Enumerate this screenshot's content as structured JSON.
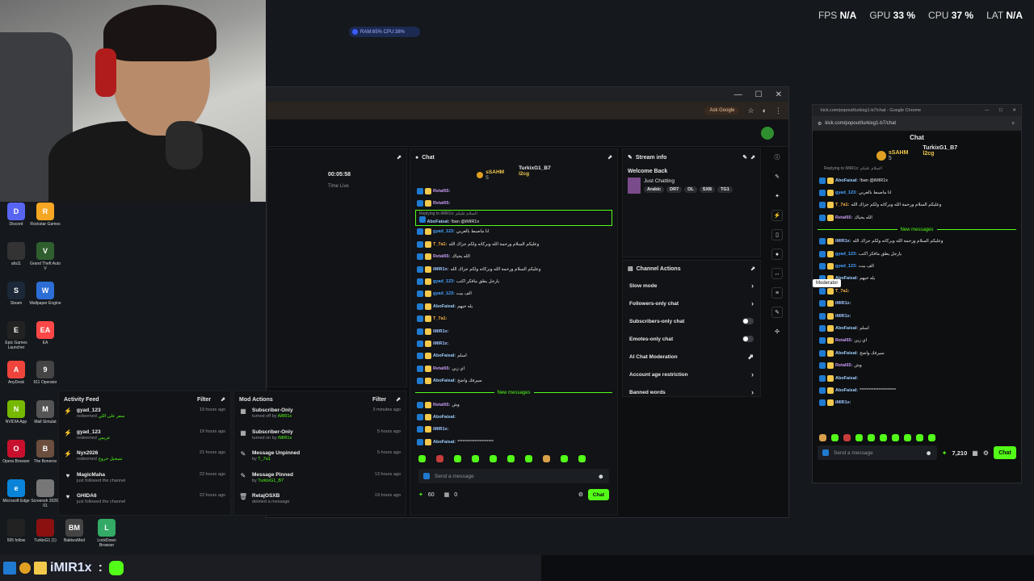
{
  "overlay": {
    "fps_label": "FPS",
    "fps_value": "N/A",
    "gpu_label": "GPU",
    "gpu_value": "33 %",
    "cpu_label": "CPU",
    "cpu_value": "37 %",
    "lat_label": "LAT",
    "lat_value": "N/A",
    "ram_pill": "RAM:65% CPU:38%"
  },
  "desktop_icons": [
    {
      "label": "Discord",
      "color": "#5865f2",
      "glyph": "D"
    },
    {
      "label": "Rockstar Games",
      "color": "#f5a623",
      "glyph": "R"
    },
    {
      "label": "afa11",
      "color": "#333",
      "glyph": ""
    },
    {
      "label": "Grand Theft Auto V",
      "color": "#2f5f2f",
      "glyph": "V"
    },
    {
      "label": "Steam",
      "color": "#1b2838",
      "glyph": "S"
    },
    {
      "label": "Wallpaper Engine",
      "color": "#2c6ed5",
      "glyph": "W"
    },
    {
      "label": "Epic Games Launcher",
      "color": "#222",
      "glyph": "E"
    },
    {
      "label": "EA",
      "color": "#ff4747",
      "glyph": "EA"
    },
    {
      "label": "AnyDesk",
      "color": "#ef443b",
      "glyph": "A"
    },
    {
      "label": "911 Operator",
      "color": "#444",
      "glyph": "9"
    },
    {
      "label": "NVIDIA App",
      "color": "#76b900",
      "glyph": "N"
    },
    {
      "label": "Mall Simulat",
      "color": "#555",
      "glyph": "M"
    },
    {
      "label": "Opera Browser",
      "color": "#c8102e",
      "glyph": "O"
    },
    {
      "label": "The Bonerov",
      "color": "#6b4e3d",
      "glyph": "B"
    },
    {
      "label": "Microsoft Edge",
      "color": "#0a84d8",
      "glyph": "e"
    },
    {
      "label": "Screensh 2026-01",
      "color": "#777",
      "glyph": ""
    },
    {
      "label": "505 follow",
      "color": "#222",
      "glyph": ""
    },
    {
      "label": "TurkixG1 (1)",
      "color": "#8b1111",
      "glyph": ""
    },
    {
      "label": "BakkesMod",
      "color": "#444",
      "glyph": "BM"
    },
    {
      "label": "LockDown Browser",
      "color": "#3a6",
      "glyph": "L"
    }
  ],
  "browser": {
    "ask_google": "Ask Google",
    "dashboard_timer": "00:05:58",
    "time_live": "Time Live"
  },
  "activity_feed": {
    "title": "Activity Feed",
    "filter": "Filter",
    "items": [
      {
        "icon": "⚡",
        "name": "gyad_123",
        "action": "redeemed",
        "detail": "سفر على اللي",
        "time": "19 hours ago"
      },
      {
        "icon": "⚡",
        "name": "gyad_123",
        "action": "redeemed",
        "detail": "عريس",
        "time": "19 hours ago"
      },
      {
        "icon": "⚡",
        "name": "Nyx2026",
        "action": "redeemed",
        "detail": "تسجيل خروج",
        "time": "21 hours ago"
      },
      {
        "icon": "♥",
        "name": "MagicMaha",
        "action": "just followed the channel",
        "detail": "",
        "time": "22 hours ago"
      },
      {
        "icon": "♥",
        "name": "GHIDA6",
        "action": "just followed the channel",
        "detail": "",
        "time": "22 hours ago"
      }
    ]
  },
  "mod_actions": {
    "title": "Mod Actions",
    "filter": "Filter",
    "items": [
      {
        "icon": "▦",
        "title": "Subscriber-Only",
        "by": "turned off by ",
        "user": "iMIR1x",
        "time": "3 minutes ago"
      },
      {
        "icon": "▦",
        "title": "Subscriber-Only",
        "by": "turned on by ",
        "user": "iMIR1x",
        "time": "5 hours ago"
      },
      {
        "icon": "✎",
        "title": "Message Unpinned",
        "by": "by ",
        "user": "T_7a1",
        "time": "5 hours ago"
      },
      {
        "icon": "✎",
        "title": "Message Pinned",
        "by": "by ",
        "user": "TurkixG1_B7",
        "time": "13 hours ago"
      },
      {
        "icon": "🗑",
        "title": "RetajOSXB",
        "by": "deleted a message",
        "user": "",
        "time": "19 hours ago"
      }
    ]
  },
  "chat": {
    "title": "Chat",
    "top1_name": "sSAHM",
    "top1_count": "5",
    "top2_name": "TurkixG1_B7",
    "top2_count": "5",
    "top3_name": "l2cg",
    "top3_count": "5",
    "reply_hint": "Replying to iMIR1x: السلام عليكم",
    "reply_user": "AboFaisal:",
    "reply_msg": "!ban @iMIR1x",
    "lines": [
      {
        "user": "Retal65:",
        "cls": "u-retal",
        "msg": ""
      },
      {
        "user": "Retal65:",
        "cls": "u-retal",
        "msg": ""
      },
      {
        "user": "gyad_123:",
        "cls": "u-gyad",
        "msg": "انا ماصبط بالعربي"
      },
      {
        "user": "T_7a1:",
        "cls": "u-t7",
        "msg": "وعليكم السلام ورحمة الله وبركاته ولكم جزاك الله"
      },
      {
        "user": "Retal65:",
        "cls": "u-retal",
        "msg": "الله يحياك"
      },
      {
        "user": "iMIR1x:",
        "cls": "u-imir",
        "msg": "وعليكم السلام ورحمة الله وبركاته ولكم جزاك الله"
      },
      {
        "user": "gyad_123:",
        "cls": "u-gyad",
        "msg": "يارجل يطق مافكر اكتب"
      },
      {
        "user": "gyad_123:",
        "cls": "u-gyad",
        "msg": "الف بيت"
      },
      {
        "user": "AboFaisal:",
        "cls": "u-abo",
        "msg": "يله حيهم"
      },
      {
        "user": "T_7a1:",
        "cls": "u-t7",
        "msg": ""
      },
      {
        "user": "iMIR1x:",
        "cls": "u-imir",
        "msg": ""
      },
      {
        "user": "iMIR1x:",
        "cls": "u-imir",
        "msg": ""
      },
      {
        "user": "AboFaisal:",
        "cls": "u-abo",
        "msg": "اسلم"
      },
      {
        "user": "Retal65:",
        "cls": "u-retal",
        "msg": "اي زين"
      },
      {
        "user": "AboFaisal:",
        "cls": "u-abo",
        "msg": "سيرفك واضح"
      }
    ],
    "new_messages": "New messages",
    "lines_after": [
      {
        "user": "Retal65:",
        "cls": "u-retal",
        "msg": "وش"
      },
      {
        "user": "AboFaisal:",
        "cls": "u-abo",
        "msg": ""
      },
      {
        "user": "iMIR1x:",
        "cls": "u-imir",
        "msg": ""
      },
      {
        "user": "AboFaisal:",
        "cls": "u-abo",
        "msg": "*********************"
      }
    ],
    "placeholder": "Send a message",
    "points": "60",
    "gift": "0",
    "send_label": "Chat"
  },
  "stream_info": {
    "title": "Stream info",
    "welcome": "Welcome Back",
    "category": "Just Chatting",
    "tags": [
      "Arabic",
      "DR7",
      "OL",
      "SXB",
      "TG1"
    ]
  },
  "channel_actions": {
    "title": "Channel Actions",
    "items": [
      {
        "label": "Slow mode",
        "type": "chevron"
      },
      {
        "label": "Followers-only chat",
        "type": "chevron"
      },
      {
        "label": "Subscribers-only chat",
        "type": "toggle"
      },
      {
        "label": "Emotes-only chat",
        "type": "toggle"
      },
      {
        "label": "AI Chat Moderation",
        "type": "external"
      },
      {
        "label": "Account age restriction",
        "type": "chevron"
      },
      {
        "label": "Banned words",
        "type": "chevron"
      }
    ]
  },
  "popout": {
    "window_title": "kick.com/popout/turkixg1-b7/chat - Google Chrome",
    "url": "kick.com/popout/turkixg1-b7/chat",
    "title": "Chat",
    "top1_name": "sSAHM",
    "top1_count": "5",
    "top2_name": "TurkixG1_B7",
    "top2_count": "5",
    "top3_name": "l2cg",
    "top3_count": "5",
    "reply_hint": "Replying to iMIR1x: السلام عليكم",
    "tooltip": "Moderator",
    "lines": [
      {
        "user": "AboFaisal:",
        "cls": "u-abo",
        "msg": "!ban @iMIR1x"
      },
      {
        "user": "gyad_123:",
        "cls": "u-gyad",
        "msg": "انا ماصبط بالعربي"
      },
      {
        "user": "T_7a1:",
        "cls": "u-t7",
        "msg": "وعليكم السلام ورحمة الله وبركاته ولكم جزاك الله"
      },
      {
        "user": "Retal65:",
        "cls": "u-retal",
        "msg": "الله يحياك"
      }
    ],
    "new_messages": "New messages",
    "lines_after": [
      {
        "user": "iMIR1x:",
        "cls": "u-imir",
        "msg": "وعليكم السلام ورحمة الله وبركاته ولكم جزاك الله"
      },
      {
        "user": "gyad_123:",
        "cls": "u-gyad",
        "msg": "يارجل يطق مافكر اكتب"
      },
      {
        "user": "gyad_123:",
        "cls": "u-gyad",
        "msg": "الف بيت"
      },
      {
        "user": "AboFaisal:",
        "cls": "u-abo",
        "msg": "يله حيهم"
      },
      {
        "user": "T_7a1:",
        "cls": "u-t7",
        "msg": ""
      },
      {
        "user": "iMIR1x:",
        "cls": "u-imir",
        "msg": ""
      },
      {
        "user": "iMIR1x:",
        "cls": "u-imir",
        "msg": ""
      },
      {
        "user": "AboFaisal:",
        "cls": "u-abo",
        "msg": "اسلم"
      },
      {
        "user": "Retal65:",
        "cls": "u-retal",
        "msg": "اي زين"
      },
      {
        "user": "AboFaisal:",
        "cls": "u-abo",
        "msg": "سيرفك واضح"
      },
      {
        "user": "Retal65:",
        "cls": "u-retal",
        "msg": "وش"
      },
      {
        "user": "AboFaisal:",
        "cls": "u-abo",
        "msg": ""
      },
      {
        "user": "AboFaisal:",
        "cls": "u-abo",
        "msg": "*********************"
      },
      {
        "user": "iMIR1x:",
        "cls": "u-imir",
        "msg": ""
      }
    ],
    "placeholder": "Send a message",
    "points": "7,210",
    "send_label": "Chat"
  },
  "taskbar": {
    "alert_name": "iMIR1x",
    "alert_sep": ":"
  }
}
